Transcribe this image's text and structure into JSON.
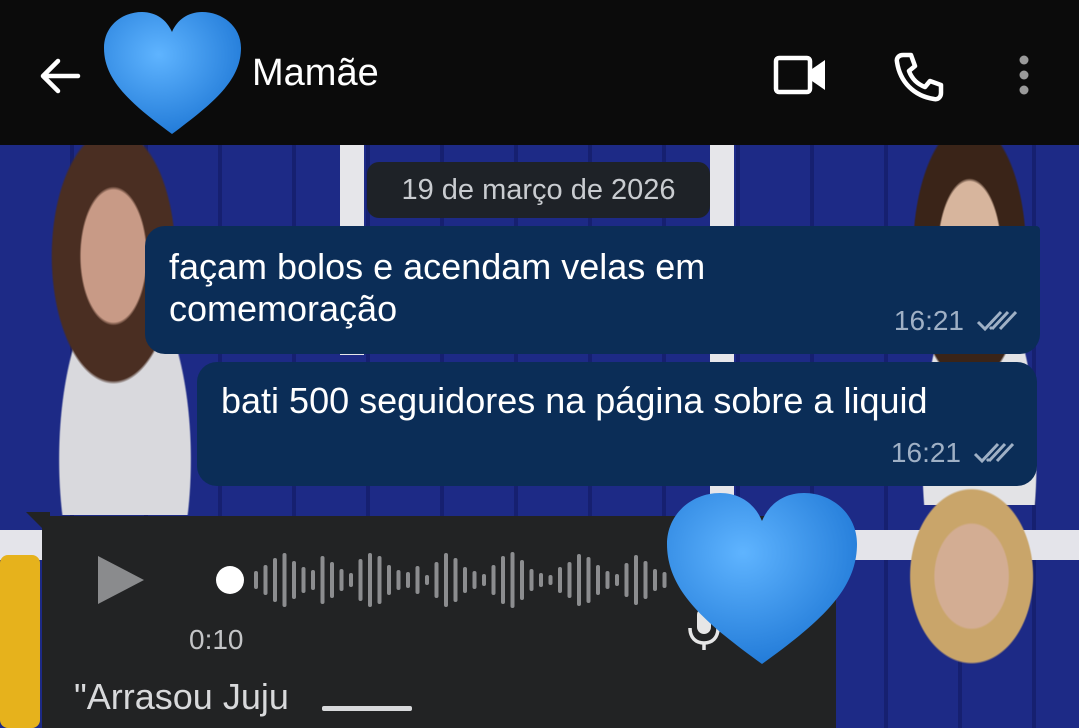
{
  "header": {
    "contact_name": "Mamãe",
    "icons": [
      "back-arrow-icon",
      "blue-heart-avatar",
      "video-call-icon",
      "phone-call-icon",
      "more-options-icon"
    ]
  },
  "chat": {
    "date_label": "19 de março de 2026",
    "messages": [
      {
        "direction": "out",
        "text": "façam bolos e acendam velas em comemoração",
        "time": "16:21",
        "status": "read"
      },
      {
        "direction": "out",
        "text": "bati 500 seguidores na página sobre a liquid",
        "time": "16:21",
        "status": "read"
      }
    ],
    "voice_message": {
      "direction": "in",
      "duration": "0:10",
      "transcript_preview": "\"Arrasou Juju"
    }
  },
  "colors": {
    "header_bg": "#0b0b0b",
    "outgoing_bubble": "#0b2d57",
    "incoming_bubble": "#222324",
    "heart": "#2e8ae6",
    "read_ticks": "#9fb0c5"
  }
}
